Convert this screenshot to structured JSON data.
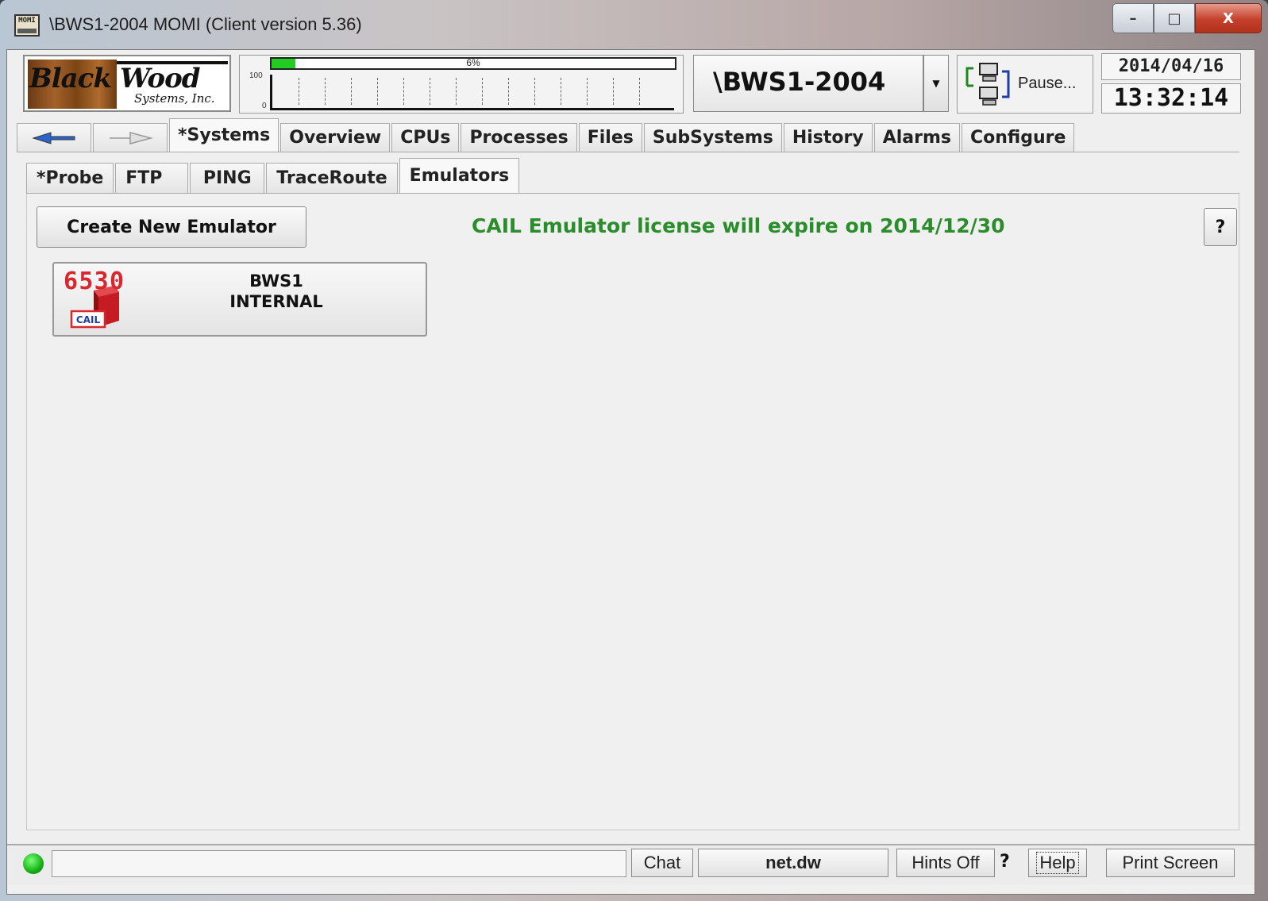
{
  "window": {
    "title": "\\BWS1-2004 MOMI (Client version 5.36)",
    "app_icon_text": "MOMI",
    "minimize": "–",
    "maximize": "□",
    "close": "X"
  },
  "header": {
    "logo": {
      "line1a": "Black",
      "line1b": "Wood",
      "line2": "Systems, Inc."
    },
    "cpu_graph": {
      "busy_percent_label": "6%",
      "busy_percent": 6,
      "y_max_label": "100",
      "y_min_label": "0"
    },
    "system_name": "\\BWS1-2004",
    "pause_label": "Pause...",
    "date": "2014/04/16",
    "time": "13:32:14"
  },
  "tabs": [
    {
      "label": "*Systems",
      "active": true
    },
    {
      "label": "Overview"
    },
    {
      "label": "CPUs"
    },
    {
      "label": "Processes"
    },
    {
      "label": "Files"
    },
    {
      "label": "SubSystems"
    },
    {
      "label": "History"
    },
    {
      "label": "Alarms"
    },
    {
      "label": "Configure"
    }
  ],
  "subtabs": [
    {
      "label": "*Probe"
    },
    {
      "label": "FTP"
    },
    {
      "label": "PING"
    },
    {
      "label": "TraceRoute"
    },
    {
      "label": "Emulators",
      "active": true
    }
  ],
  "content": {
    "create_button": "Create New Emulator",
    "license_message": "CAIL Emulator license will expire on 2014/12/30",
    "help_button": "?",
    "emulators": [
      {
        "model": "6530",
        "brand": "CAIL",
        "line1": "BWS1",
        "line2": "INTERNAL"
      }
    ]
  },
  "statusbar": {
    "chat": "Chat",
    "net_file": "net.dw",
    "hints": "Hints Off",
    "question": "?",
    "help": "Help",
    "print_screen": "Print Screen"
  },
  "colors": {
    "license_text": "#2a8c2a",
    "status_led": "#15b015",
    "graph_fill": "#22cc22",
    "emulator_logo": "#d8272e"
  }
}
